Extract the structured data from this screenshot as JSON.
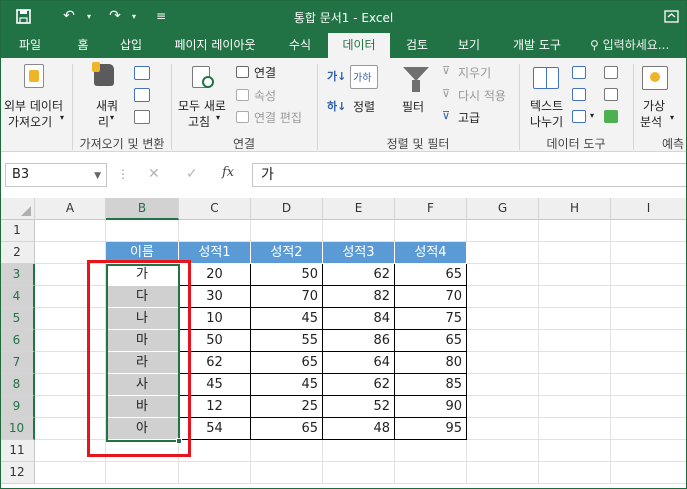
{
  "titlebar": {
    "title": "통합 문서1 - Excel",
    "save_glyph": "💾",
    "undo_glyph": "↶",
    "redo_glyph": "↷",
    "customize_glyph": "≡"
  },
  "tabs": [
    "파일",
    "홈",
    "삽입",
    "페이지 레이아웃",
    "수식",
    "데이터",
    "검토",
    "보기",
    "개발 도구"
  ],
  "tell_me": "입력하세요...",
  "ribbon": {
    "external_data": [
      "외부 데이터",
      "가져오기"
    ],
    "new_query": [
      "새쿼",
      "리"
    ],
    "refresh_all": [
      "모두 새로",
      "고침"
    ],
    "connections": "연결",
    "properties": "속성",
    "edit_links": "연결 편집",
    "sort": "정렬",
    "filter": "필터",
    "clear": "지우기",
    "reapply": "다시 적용",
    "advanced": "고급",
    "text_to_columns": [
      "텍스트",
      "나누기"
    ],
    "what_if": [
      "가상",
      "분석"
    ],
    "sort_az_label": "가",
    "sort_az_label2": "하",
    "sort_box_top": "가하",
    "groups": {
      "get_transform": "가져오기 및 변환",
      "connections": "연결",
      "sort_filter": "정렬 및 필터",
      "data_tools": "데이터 도구",
      "forecast": "예측"
    }
  },
  "formula_bar": {
    "name_box": "B3",
    "formula": "가",
    "fx": "fx",
    "cancel": "✕",
    "enter": "✓",
    "dots": "⋮"
  },
  "grid": {
    "columns": [
      "A",
      "B",
      "C",
      "D",
      "E",
      "F",
      "G",
      "H",
      "I"
    ],
    "rows": [
      "1",
      "2",
      "3",
      "4",
      "5",
      "6",
      "7",
      "8",
      "9",
      "10",
      "11",
      "12"
    ],
    "headers": [
      "이름",
      "성적1",
      "성적2",
      "성적3",
      "성적4"
    ],
    "records": [
      {
        "name": "가",
        "s1": "20",
        "s2": "50",
        "s3": "62",
        "s4": "65"
      },
      {
        "name": "다",
        "s1": "30",
        "s2": "70",
        "s3": "82",
        "s4": "70"
      },
      {
        "name": "나",
        "s1": "10",
        "s2": "45",
        "s3": "84",
        "s4": "75"
      },
      {
        "name": "마",
        "s1": "50",
        "s2": "55",
        "s3": "86",
        "s4": "65"
      },
      {
        "name": "라",
        "s1": "62",
        "s2": "65",
        "s3": "64",
        "s4": "80"
      },
      {
        "name": "사",
        "s1": "45",
        "s2": "45",
        "s3": "62",
        "s4": "85"
      },
      {
        "name": "바",
        "s1": "12",
        "s2": "25",
        "s3": "52",
        "s4": "90"
      },
      {
        "name": "아",
        "s1": "54",
        "s2": "65",
        "s3": "48",
        "s4": "95"
      }
    ]
  },
  "colors": {
    "excel_green": "#217346",
    "table_header": "#5b9bd5",
    "highlight_red": "#e8141b",
    "name_cells": "#d0d0d0"
  }
}
